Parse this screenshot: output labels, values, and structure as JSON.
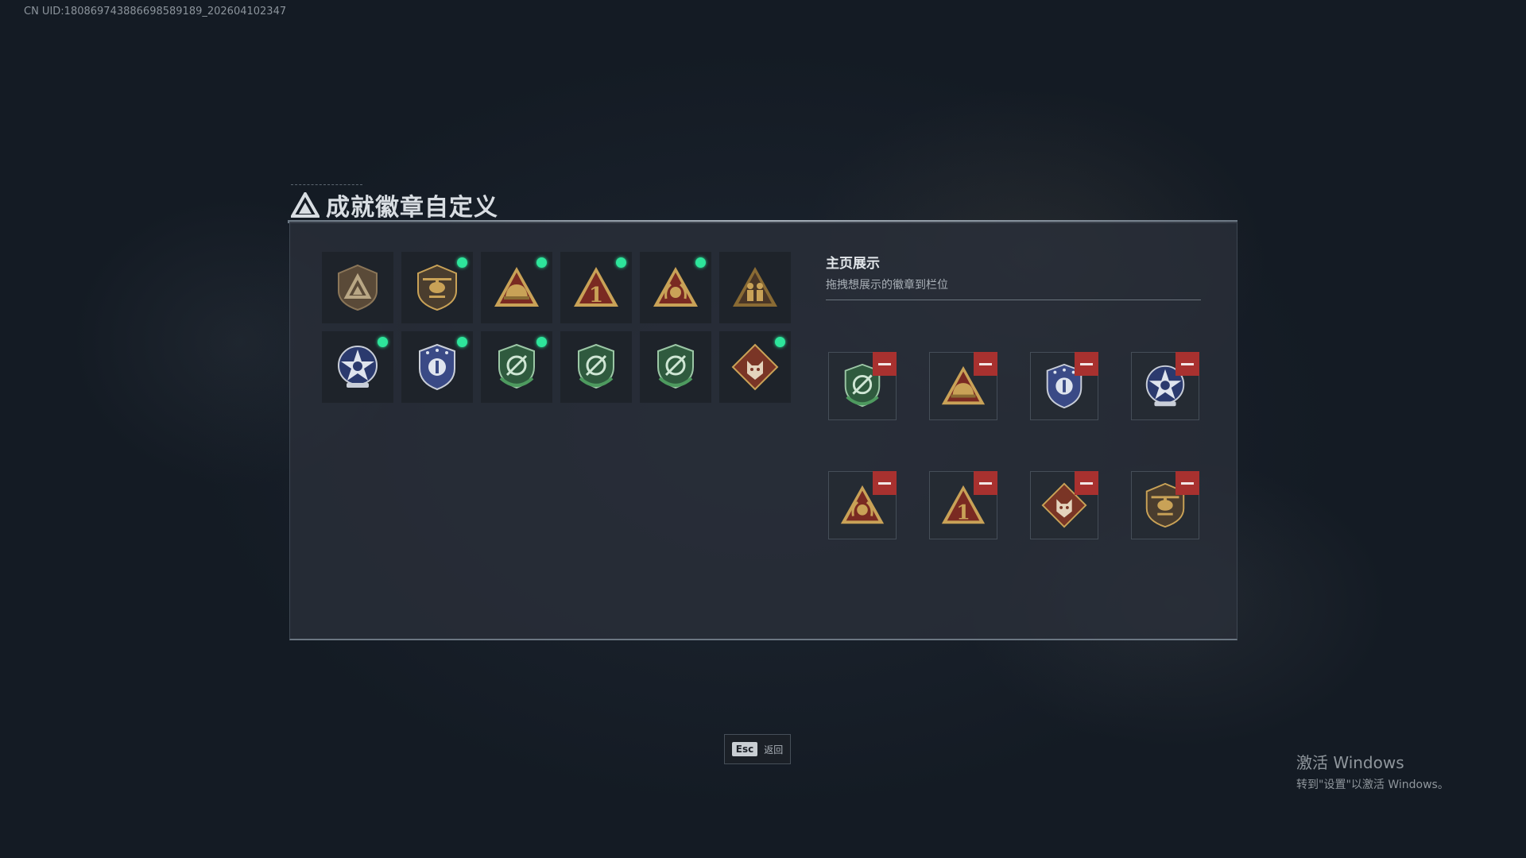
{
  "uid": "CN UID:180869743886698589189_202604102347",
  "page_title": "成就徽章自定义",
  "badges": [
    {
      "icon": "shield-triangle-badge-icon",
      "selected": false
    },
    {
      "icon": "helicopter-badge-icon",
      "selected": true
    },
    {
      "icon": "helmet-triangle-badge-icon",
      "selected": true
    },
    {
      "icon": "number-one-triangle-badge-icon",
      "selected": true
    },
    {
      "icon": "wreath-triangle-badge-icon",
      "selected": true
    },
    {
      "icon": "soldiers-triangle-badge-icon",
      "selected": false
    },
    {
      "icon": "star-emblem-badge-icon",
      "selected": true
    },
    {
      "icon": "police-shield-badge-icon",
      "selected": true
    },
    {
      "icon": "green-crest-badge-icon",
      "selected": true
    },
    {
      "icon": "green-crest-badge-icon",
      "selected": false
    },
    {
      "icon": "green-crest-badge-icon",
      "selected": false
    },
    {
      "icon": "wolf-diamond-badge-icon",
      "selected": true
    }
  ],
  "showcase": {
    "title": "主页展示",
    "subtitle": "拖拽想展示的徽章到栏位",
    "slots": [
      {
        "icon": "green-crest-badge-icon"
      },
      {
        "icon": "helmet-triangle-badge-icon"
      },
      {
        "icon": "police-shield-badge-icon"
      },
      {
        "icon": "star-emblem-badge-icon"
      },
      {
        "icon": "wreath-triangle-badge-icon"
      },
      {
        "icon": "number-one-triangle-badge-icon"
      },
      {
        "icon": "wolf-diamond-badge-icon"
      },
      {
        "icon": "helicopter-badge-icon"
      }
    ]
  },
  "footer": {
    "esc_key": "Esc",
    "esc_label": "返回"
  },
  "windows_activation": {
    "line1": "激活 Windows",
    "line2": "转到\"设置\"以激活 Windows。"
  },
  "colors": {
    "accent_green": "#2ee59b",
    "remove_red": "#a8312f",
    "gold": "#c9a257"
  }
}
